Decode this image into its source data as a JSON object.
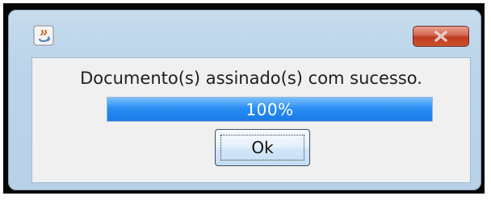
{
  "dialog": {
    "message": "Documento(s) assinado(s) com sucesso.",
    "progress_value": 1.0,
    "progress_label": "100%",
    "ok_label": "Ok"
  },
  "icons": {
    "app_icon": "java-icon",
    "close_icon": "close-icon"
  },
  "colors": {
    "titlebar": "#bcd5ea",
    "close_button": "#c23a1e",
    "progress_fill": "#2a8ef3",
    "content_background": "#f0f0f0"
  }
}
